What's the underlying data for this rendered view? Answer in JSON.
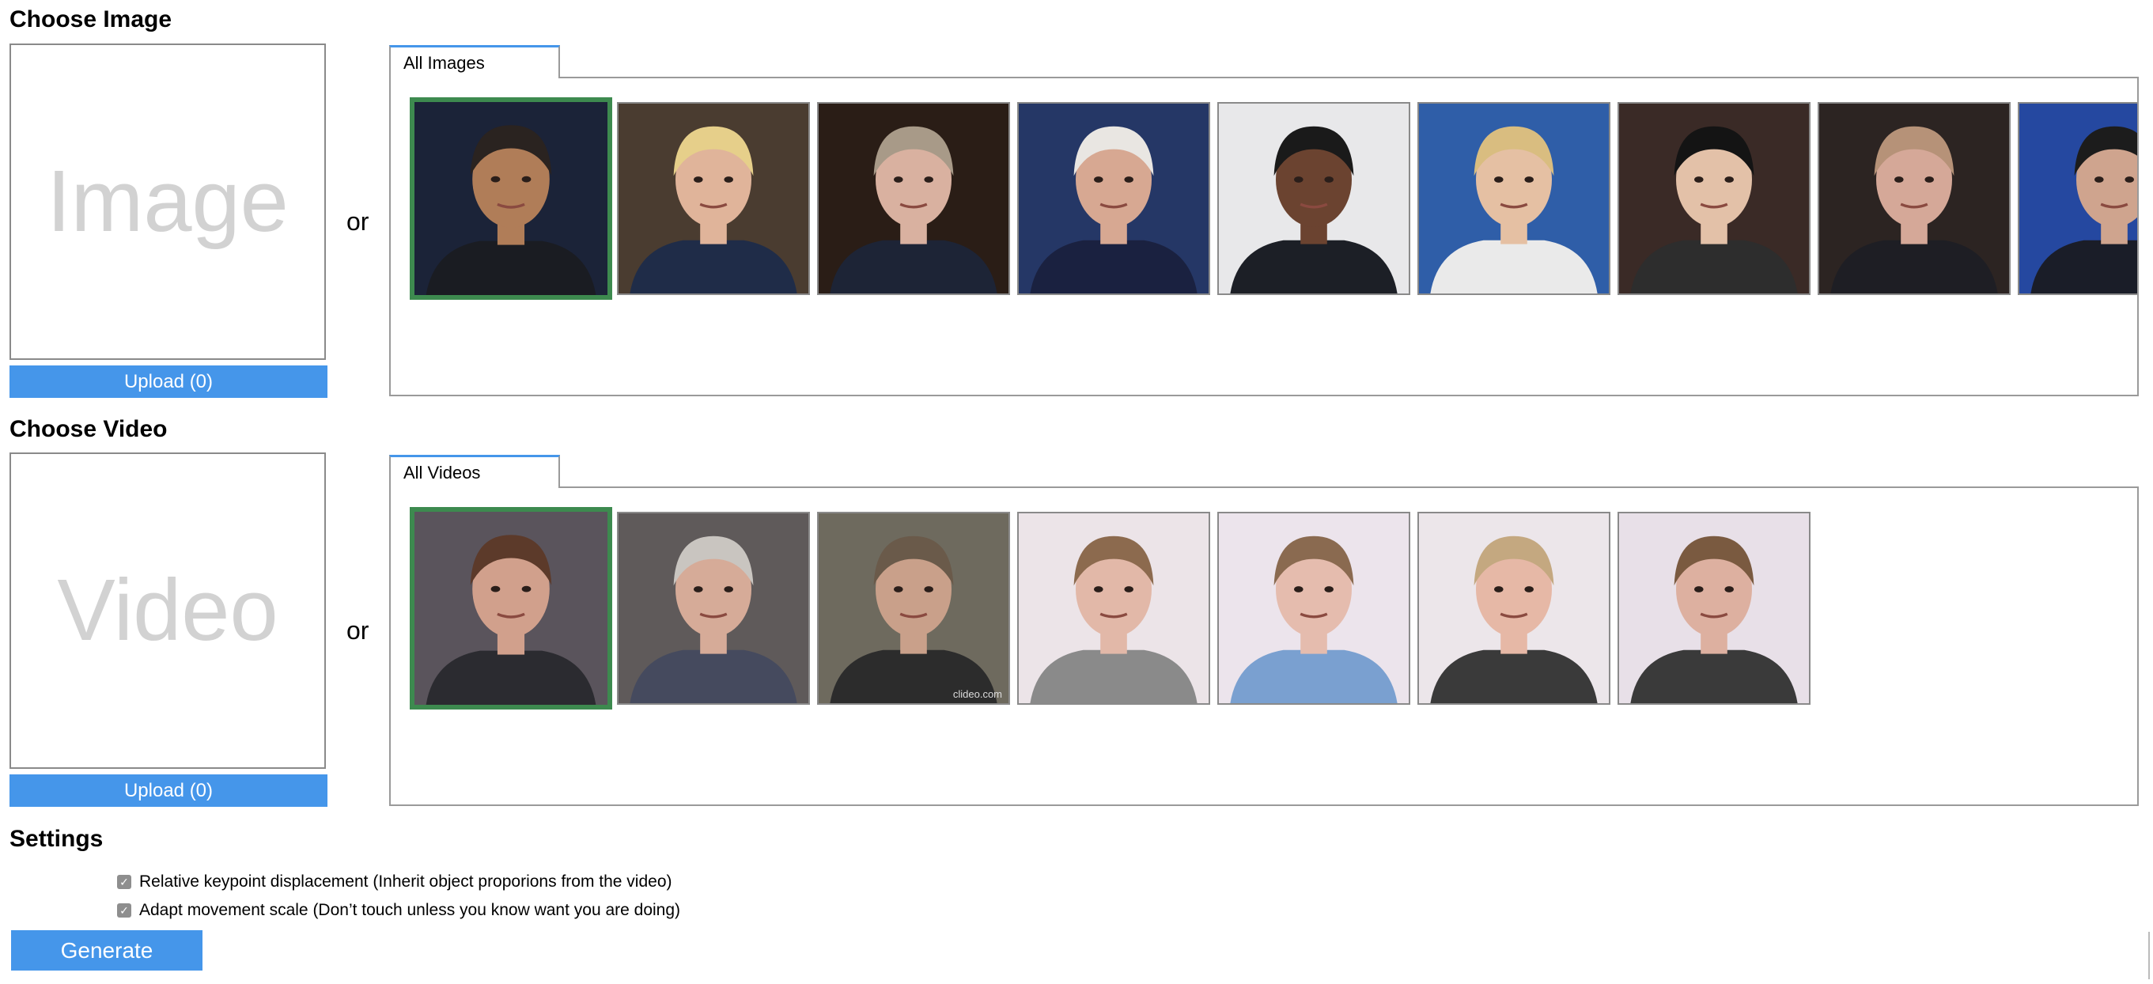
{
  "image_section": {
    "title": "Choose Image",
    "placeholder": "Image",
    "upload_label": "Upload (0)",
    "or": "or",
    "tab_label": "All Images",
    "thumbnails": [
      {
        "name": "image-thumb-1",
        "bg": "#1b2338",
        "skin": "#b07d58",
        "hair": "#2a2320",
        "suit": "#1a1c22"
      },
      {
        "name": "image-thumb-2",
        "bg": "#4a3c30",
        "skin": "#e0b49a",
        "hair": "#e6cf8a",
        "suit": "#1f2c48"
      },
      {
        "name": "image-thumb-3",
        "bg": "#2a1d16",
        "skin": "#d9b1a0",
        "hair": "#a89a88",
        "suit": "#1d2436"
      },
      {
        "name": "image-thumb-4",
        "bg": "#253766",
        "skin": "#d7a892",
        "hair": "#e9e6e2",
        "suit": "#1a2140"
      },
      {
        "name": "image-thumb-5",
        "bg": "#e8e8ea",
        "skin": "#6b4330",
        "hair": "#1a1a1a",
        "suit": "#1c1f26"
      },
      {
        "name": "image-thumb-6",
        "bg": "#2f5ea8",
        "skin": "#e5c0a3",
        "hair": "#d9bd80",
        "suit": "#eaeaea"
      },
      {
        "name": "image-thumb-7",
        "bg": "#3a2a26",
        "skin": "#e3c1a8",
        "hair": "#141414",
        "suit": "#2d2d2d"
      },
      {
        "name": "image-thumb-8",
        "bg": "#2c2422",
        "skin": "#d5a898",
        "hair": "#b69278",
        "suit": "#1e1e24"
      },
      {
        "name": "image-thumb-9",
        "bg": "#2548a0",
        "skin": "#cfa48e",
        "hair": "#1c1c1c",
        "suit": "#1a1d28"
      }
    ]
  },
  "video_section": {
    "title": "Choose Video",
    "placeholder": "Video",
    "upload_label": "Upload (0)",
    "or": "or",
    "tab_label": "All Videos",
    "thumbnails": [
      {
        "name": "video-thumb-1",
        "bg": "#5a545c",
        "skin": "#d1a08c",
        "hair": "#5c3a2a",
        "suit": "#2b2b30"
      },
      {
        "name": "video-thumb-2",
        "bg": "#5f5a5a",
        "skin": "#d6ab98",
        "hair": "#c9c5c0",
        "suit": "#454a5e"
      },
      {
        "name": "video-thumb-3",
        "bg": "#6e6a5e",
        "skin": "#c9a08a",
        "hair": "#6a5a4a",
        "suit": "#2c2c2c",
        "watermark": "clideo.com"
      },
      {
        "name": "video-thumb-4",
        "bg": "#ece4e8",
        "skin": "#e2b8a8",
        "hair": "#8c6a4e",
        "suit": "#8a8a8a"
      },
      {
        "name": "video-thumb-5",
        "bg": "#ece4ec",
        "skin": "#e5bcae",
        "hair": "#8a6a50",
        "suit": "#7aa0d0"
      },
      {
        "name": "video-thumb-6",
        "bg": "#ece6ea",
        "skin": "#e6b8a6",
        "hair": "#c4a880",
        "suit": "#3a3a3a"
      },
      {
        "name": "video-thumb-7",
        "bg": "#e8e0e8",
        "skin": "#ddb0a0",
        "hair": "#7a5a40",
        "suit": "#3a3a3a"
      }
    ]
  },
  "settings": {
    "title": "Settings",
    "options": [
      {
        "label": "Relative keypoint displacement (Inherit object proporions from the video)",
        "checked": true
      },
      {
        "label": "Adapt movement scale (Don’t touch unless you know want you are doing)",
        "checked": true
      }
    ],
    "check_glyph": "✓"
  },
  "generate_label": "Generate",
  "colors": {
    "accent": "#4596ea",
    "selected_border": "#3d8a4f"
  }
}
